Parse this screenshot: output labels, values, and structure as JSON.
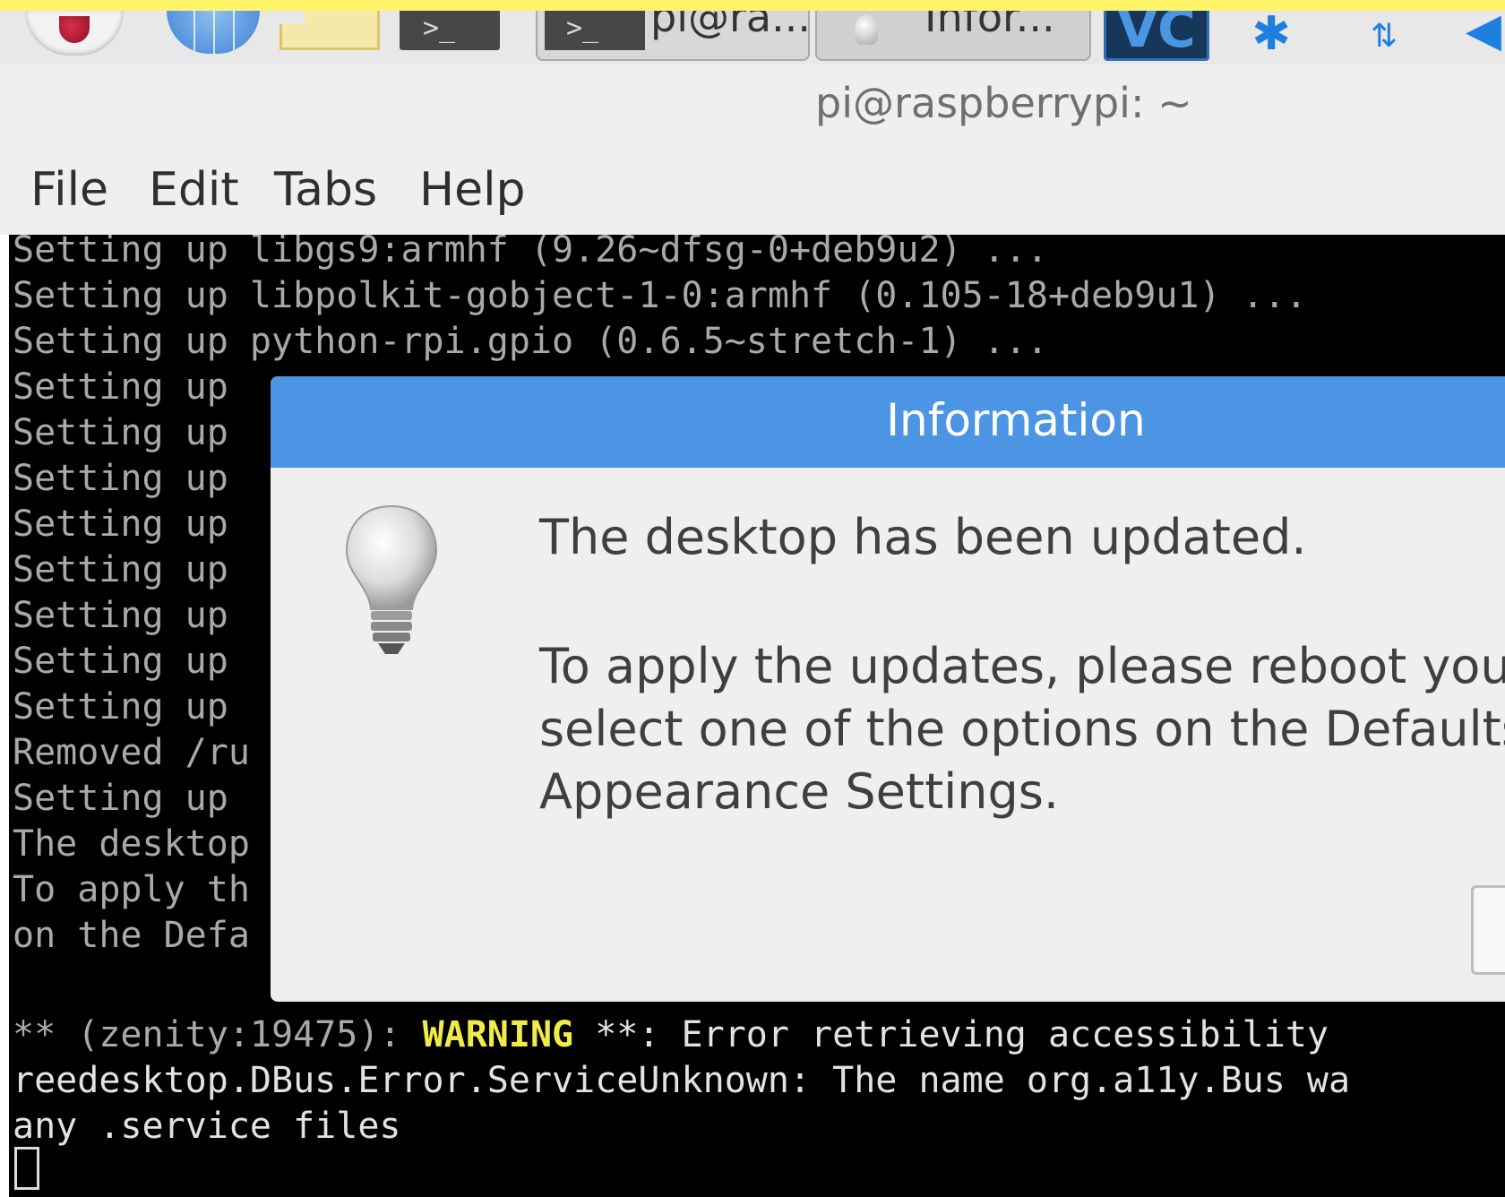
{
  "taskbar": {
    "tasks": [
      {
        "label": "pi@ra..."
      },
      {
        "label": "Infor..."
      }
    ],
    "vc_label": "VC",
    "term_glyph": ">_"
  },
  "window": {
    "title": "pi@raspberrypi: ~",
    "menu": [
      "File",
      "Edit",
      "Tabs",
      "Help"
    ]
  },
  "terminal": {
    "lines": [
      "Setting up libgs9:armhf (9.26~dfsg-0+deb9u2) ...",
      "Setting up libpolkit-gobject-1-0:armhf (0.105-18+deb9u1) ...",
      "Setting up python-rpi.gpio (0.6.5~stretch-1) ...",
      "Setting up",
      "Setting up",
      "Setting up",
      "Setting up",
      "Setting up",
      "Setting up",
      "Setting up",
      "Setting up",
      "Removed /ru",
      "Setting up",
      "The desktop",
      "To apply th",
      "on the Defa"
    ],
    "warning_prefix": "** (zenity:19475): ",
    "warning_word": "WARNING",
    "warning_rest": " **: Error retrieving accessibility",
    "line2": "reedesktop.DBus.Error.ServiceUnknown: The name org.a11y.Bus wa",
    "line3": "any .service files"
  },
  "dialog": {
    "title": "Information",
    "message_1": "The desktop has been updated.",
    "message_2": "To apply the updates, please reboot your Pi, a",
    "message_3": "select one of the options on the Defaults page",
    "message_4": "Appearance Settings."
  },
  "colors": {
    "dialog_header": "#4c94e4",
    "warning": "#f0ea4a",
    "terminal_bg": "#000000"
  }
}
